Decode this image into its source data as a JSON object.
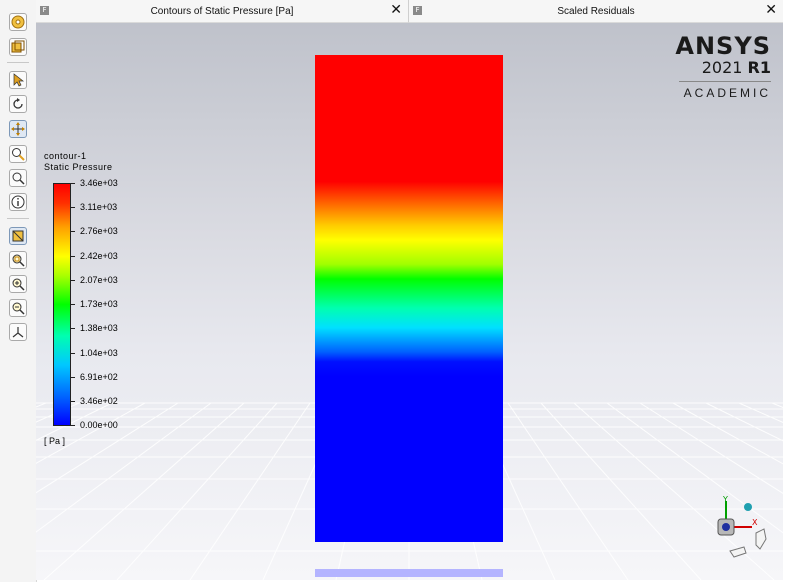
{
  "toolbar": {
    "icons": [
      "wheel-icon",
      "fit-icon",
      "pointer-icon",
      "rotate-icon",
      "pan-icon",
      "zoom-icon",
      "zoom-box-icon",
      "info-icon",
      "cut-icon",
      "zoom-fit-icon",
      "zoom-in-icon",
      "zoom-out-icon",
      "axes-icon"
    ]
  },
  "tabs": [
    {
      "title": "Contours of Static Pressure [Pa]",
      "icon_text": "F",
      "close": "✕"
    },
    {
      "title": "Scaled Residuals",
      "icon_text": "F",
      "close": "✕"
    }
  ],
  "logo": {
    "brand": "ANSYS",
    "version": "2021",
    "release": "R1",
    "edition": "ACADEMIC"
  },
  "legend": {
    "name": "contour-1",
    "quantity": "Static Pressure",
    "unit": "[ Pa ]",
    "ticks": [
      "3.46e+03",
      "3.11e+03",
      "2.76e+03",
      "2.42e+03",
      "2.07e+03",
      "1.73e+03",
      "1.38e+03",
      "1.04e+03",
      "6.91e+02",
      "3.46e+02",
      "0.00e+00"
    ],
    "colors": {
      "max": "#ff0000",
      "mid": "#00ff00",
      "min": "#0000ff"
    }
  }
}
